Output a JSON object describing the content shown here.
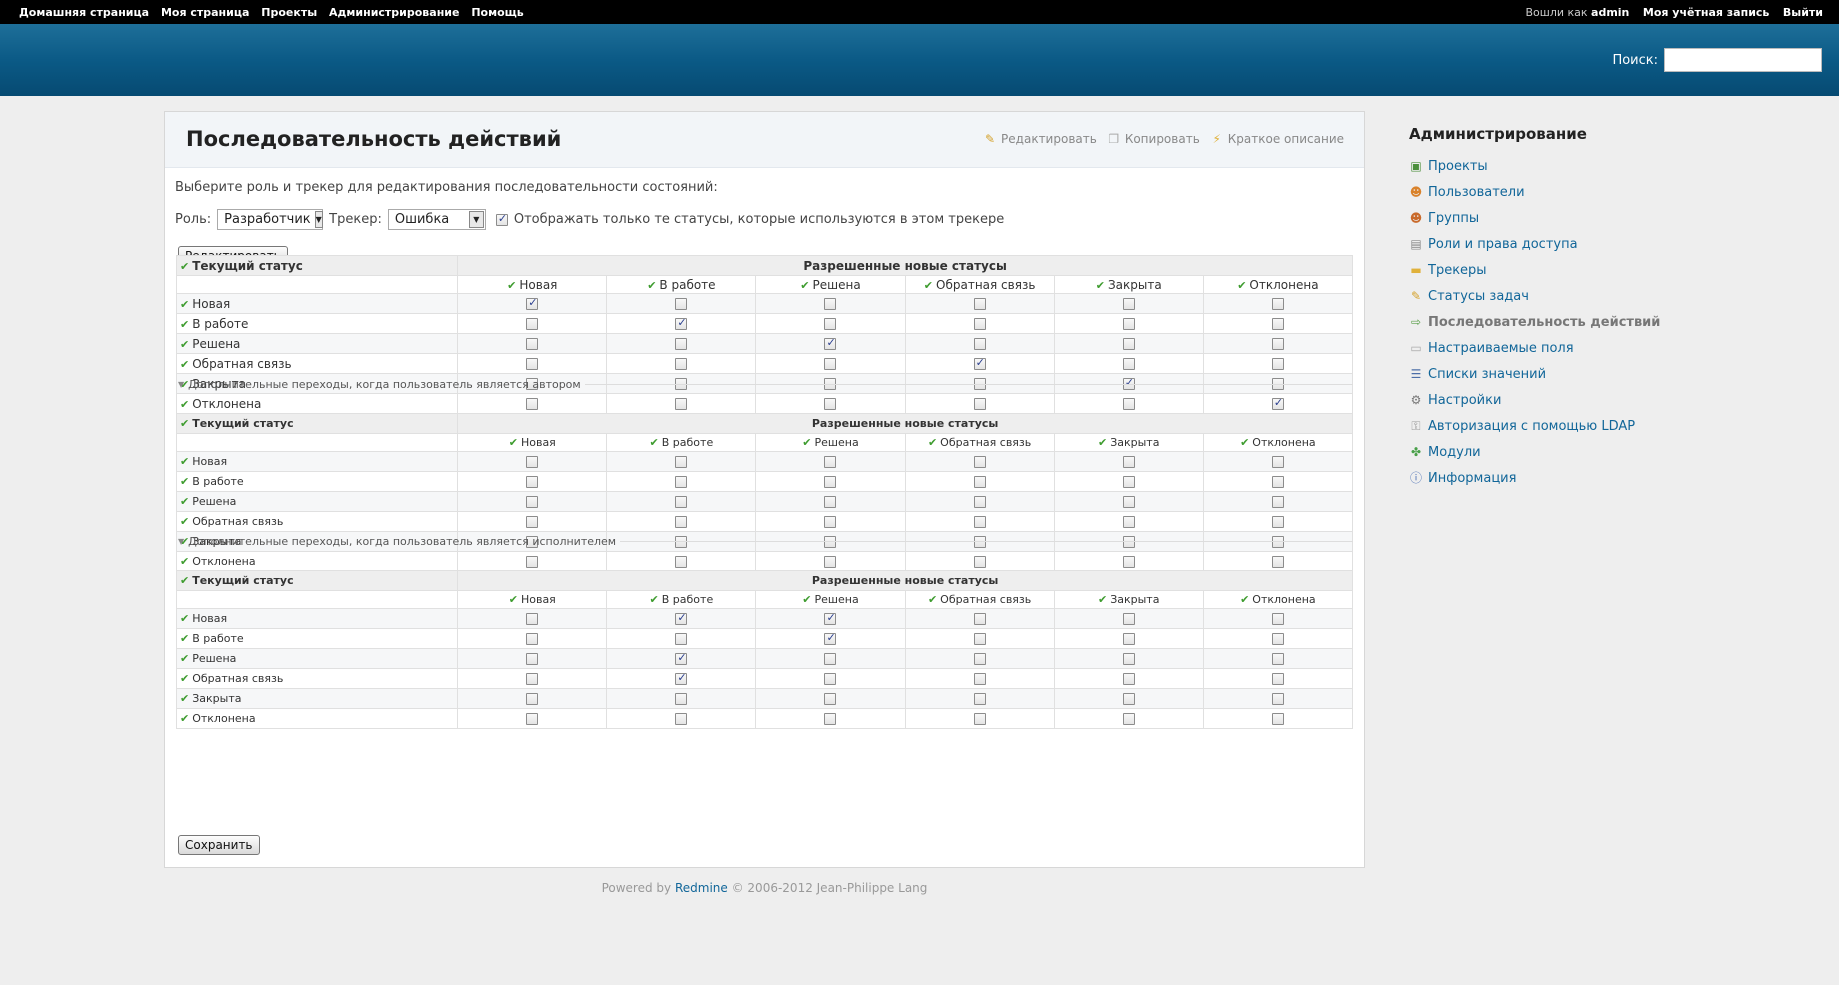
{
  "top_menu": {
    "items": [
      "Домашняя страница",
      "Моя страница",
      "Проекты",
      "Администрирование",
      "Помощь"
    ],
    "logged_as_prefix": "Вошли как",
    "user": "admin",
    "my_account": "Моя учётная запись",
    "logout": "Выйти"
  },
  "header": {
    "search_label": "Поиск:",
    "search_value": ""
  },
  "page": {
    "title": "Последовательность действий",
    "actions": {
      "edit": "Редактировать",
      "copy": "Копировать",
      "summary": "Краткое описание"
    },
    "intro": "Выберите роль и трекер для редактирования последовательности состояний:",
    "role_label": "Роль:",
    "role_value": "Разработчик",
    "tracker_label": "Трекер:",
    "tracker_value": "Ошибка",
    "used_only_label": "Отображать только те статусы, которые используются в этом трекере",
    "used_only_checked": true,
    "edit_button": "Редактировать",
    "save_button": "Сохранить"
  },
  "workflow": {
    "current_status_header": "Текущий статус",
    "allowed_header": "Разрешенные новые статусы",
    "statuses": [
      "Новая",
      "В работе",
      "Решена",
      "Обратная связь",
      "Закрыта",
      "Отклонена"
    ],
    "tables": [
      {
        "legend": "",
        "matrix": [
          [
            1,
            0,
            0,
            0,
            0,
            0
          ],
          [
            0,
            1,
            0,
            0,
            0,
            0
          ],
          [
            0,
            0,
            1,
            0,
            0,
            0
          ],
          [
            0,
            0,
            0,
            1,
            0,
            0
          ],
          [
            0,
            0,
            0,
            0,
            1,
            0
          ],
          [
            0,
            0,
            0,
            0,
            0,
            1
          ]
        ]
      },
      {
        "legend": "Дополнительные переходы, когда пользователь является автором",
        "matrix": [
          [
            0,
            0,
            0,
            0,
            0,
            0
          ],
          [
            0,
            0,
            0,
            0,
            0,
            0
          ],
          [
            0,
            0,
            0,
            0,
            0,
            0
          ],
          [
            0,
            0,
            0,
            0,
            0,
            0
          ],
          [
            0,
            0,
            0,
            0,
            0,
            0
          ],
          [
            0,
            0,
            0,
            0,
            0,
            0
          ]
        ]
      },
      {
        "legend": "Дополнительные переходы, когда пользователь является исполнителем",
        "matrix": [
          [
            0,
            1,
            1,
            0,
            0,
            0
          ],
          [
            0,
            0,
            1,
            0,
            0,
            0
          ],
          [
            0,
            1,
            0,
            0,
            0,
            0
          ],
          [
            0,
            1,
            0,
            0,
            0,
            0
          ],
          [
            0,
            0,
            0,
            0,
            0,
            0
          ],
          [
            0,
            0,
            0,
            0,
            0,
            0
          ]
        ]
      }
    ]
  },
  "sidebar": {
    "title": "Администрирование",
    "items": [
      {
        "label": "Проекты",
        "icon": "projects-icon",
        "glyph": "▣",
        "color": "#4a8f3a"
      },
      {
        "label": "Пользователи",
        "icon": "user-icon",
        "glyph": "☻",
        "color": "#d9822b"
      },
      {
        "label": "Группы",
        "icon": "group-icon",
        "glyph": "☻",
        "color": "#c96a2b"
      },
      {
        "label": "Роли и права доступа",
        "icon": "permissions-icon",
        "glyph": "▤",
        "color": "#888888"
      },
      {
        "label": "Трекеры",
        "icon": "tracker-icon",
        "glyph": "▬",
        "color": "#e0b13a"
      },
      {
        "label": "Статусы задач",
        "icon": "status-icon",
        "glyph": "✎",
        "color": "#d4a12a"
      },
      {
        "label": "Последовательность действий",
        "icon": "workflow-icon",
        "glyph": "⇨",
        "color": "#5aa04a",
        "selected": true
      },
      {
        "label": "Настраиваемые поля",
        "icon": "custom-field-icon",
        "glyph": "▭",
        "color": "#aaaaaa"
      },
      {
        "label": "Списки значений",
        "icon": "list-icon",
        "glyph": "☰",
        "color": "#4d6fa8"
      },
      {
        "label": "Настройки",
        "icon": "gear-icon",
        "glyph": "⚙",
        "color": "#777777"
      },
      {
        "label": "Авторизация с помощью LDAP",
        "icon": "ldap-icon",
        "glyph": "⚿",
        "color": "#999999"
      },
      {
        "label": "Модули",
        "icon": "plugin-icon",
        "glyph": "✤",
        "color": "#4aa04a"
      },
      {
        "label": "Информация",
        "icon": "info-icon",
        "glyph": "ⓘ",
        "color": "#4a6fb5"
      }
    ]
  },
  "footer": {
    "powered_by": "Powered by",
    "link": "Redmine",
    "copyright": "© 2006-2012 Jean-Philippe Lang"
  },
  "colors": {
    "header_bg": "#0b5a86",
    "link": "#116699",
    "check": "#3e9c2f"
  }
}
